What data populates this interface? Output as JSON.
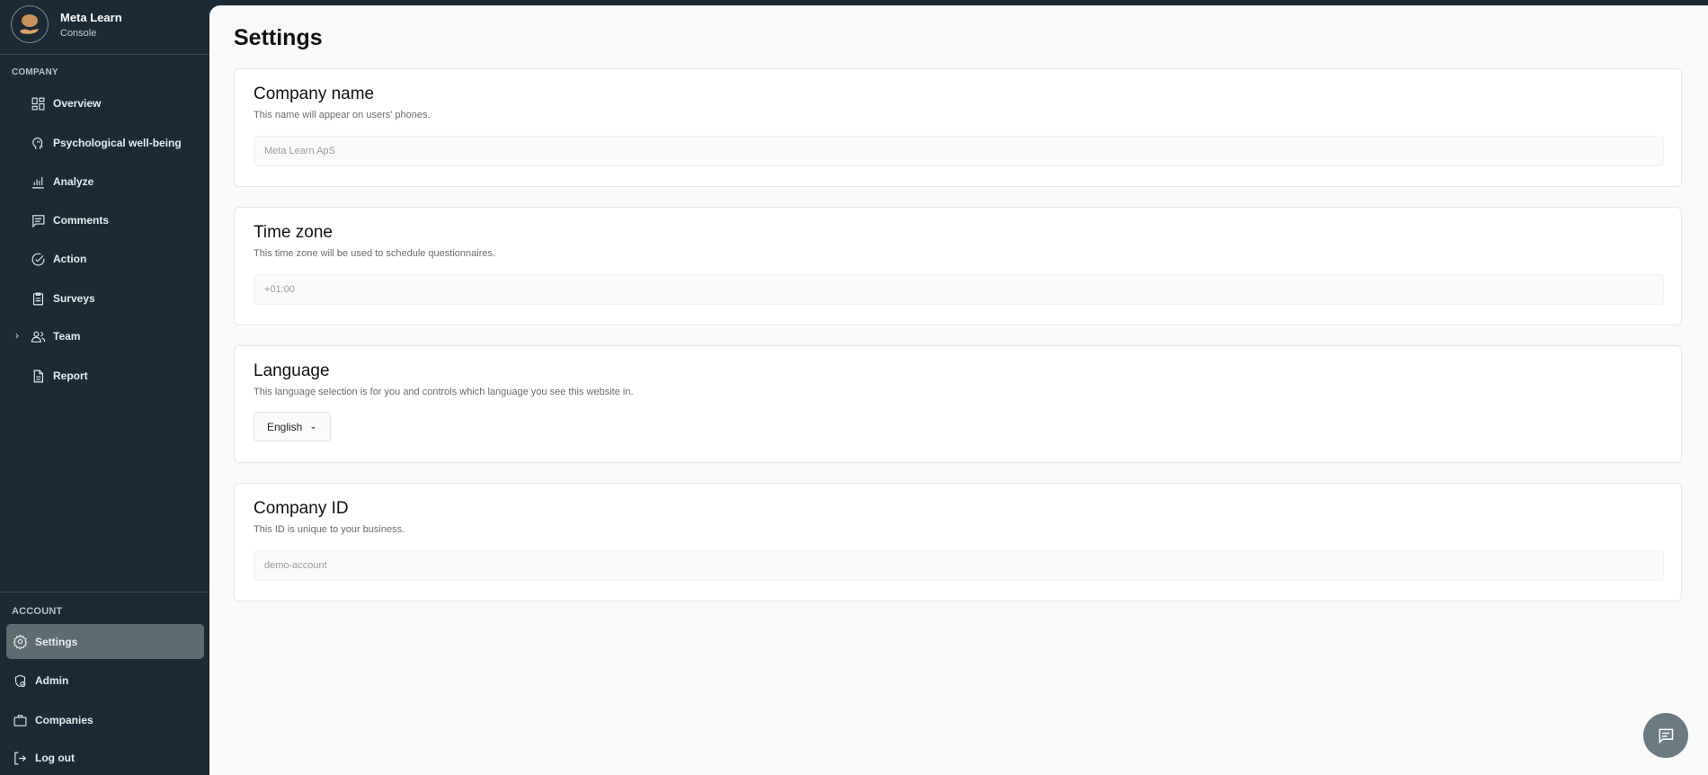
{
  "brand": {
    "name": "Meta Learn",
    "subtitle": "Console"
  },
  "sidebar": {
    "company_label": "COMPANY",
    "company_items": [
      {
        "label": "Overview",
        "icon": "grid-icon"
      },
      {
        "label": "Psychological well-being",
        "icon": "head-icon"
      },
      {
        "label": "Analyze",
        "icon": "bar-chart-icon"
      },
      {
        "label": "Comments",
        "icon": "comment-icon"
      },
      {
        "label": "Action",
        "icon": "check-circle-icon"
      },
      {
        "label": "Surveys",
        "icon": "clipboard-icon"
      },
      {
        "label": "Team",
        "icon": "users-icon"
      },
      {
        "label": "Report",
        "icon": "document-icon"
      }
    ],
    "account_label": "ACCOUNT",
    "account_items": [
      {
        "label": "Settings",
        "icon": "gear-icon",
        "active": true
      },
      {
        "label": "Admin",
        "icon": "shield-user-icon"
      },
      {
        "label": "Companies",
        "icon": "briefcase-icon"
      },
      {
        "label": "Log out",
        "icon": "logout-icon"
      }
    ]
  },
  "page": {
    "title": "Settings"
  },
  "cards": {
    "company_name": {
      "title": "Company name",
      "description": "This name will appear on users' phones.",
      "value": "Meta Learn ApS"
    },
    "time_zone": {
      "title": "Time zone",
      "description": "This time zone will be used to schedule questionnaires.",
      "value": "+01:00"
    },
    "language": {
      "title": "Language",
      "description": "This language selection is for you and controls which language you see this website in.",
      "selected": "English"
    },
    "company_id": {
      "title": "Company ID",
      "description": "This ID is unique to your business.",
      "value": "demo-account"
    }
  },
  "colors": {
    "sidebar": "#1b2a35",
    "active_item": "#5e6b71",
    "chat_button": "#6b7a80"
  }
}
